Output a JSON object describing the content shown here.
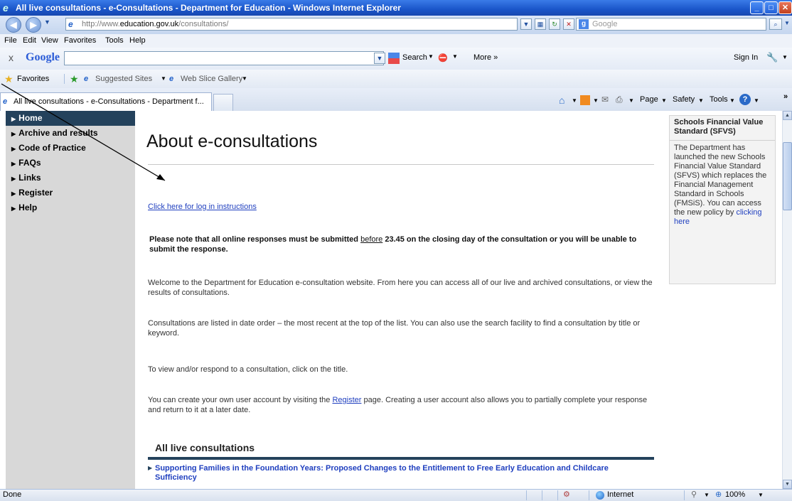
{
  "window": {
    "title": "All live consultations - e-Consultations - Department for Education - Windows Internet Explorer"
  },
  "address": {
    "url_prefix": "http://www.",
    "url_host": "education.gov.uk",
    "url_path": "/consultations/",
    "search_placeholder": "Google"
  },
  "menu": [
    "File",
    "Edit",
    "View",
    "Favorites",
    "Tools",
    "Help"
  ],
  "google_toolbar": {
    "close": "x",
    "brand": "Google",
    "search_label": "Search",
    "more_label": "More »",
    "signin_label": "Sign In"
  },
  "favorites_bar": {
    "favorites_label": "Favorites",
    "suggested_sites": "Suggested Sites",
    "web_slice_gallery": "Web Slice Gallery"
  },
  "tab": {
    "label": "All live consultations - e-Consultations - Department f..."
  },
  "command_bar": {
    "page": "Page",
    "safety": "Safety",
    "tools": "Tools"
  },
  "left_nav": [
    {
      "label": "Home",
      "active": true
    },
    {
      "label": "Archive and results",
      "active": false
    },
    {
      "label": "Code of Practice",
      "active": false
    },
    {
      "label": "FAQs",
      "active": false
    },
    {
      "label": "Links",
      "active": false
    },
    {
      "label": "Register",
      "active": false
    },
    {
      "label": "Help",
      "active": false
    }
  ],
  "main": {
    "heading": "About e-consultations",
    "login_link": "Click here for log in instructions",
    "notice_part1": "Please note that all online responses must be submitted ",
    "notice_underlined": "before",
    "notice_part2": " 23.45 on the closing day of the consultation or you will be unable to submit the response.",
    "para1": "Welcome to the Department for Education e-consultation website. From here you can access all of our live and archived consultations, or view the results of consultations.",
    "para2": "Consultations are listed in date order – the most recent at the top of the list.  You can also use the search facility to find a consultation by title or keyword.",
    "para3": "To view and/or respond to a consultation, click on the title.",
    "para4_part1": "You can create your own user account by visiting the ",
    "para4_link": "Register",
    "para4_part2": " page. Creating a user account also allows you to partially complete your response and return to it at a later date.",
    "live_heading": "All live consultations",
    "consultation_link": "Supporting Families in the Foundation Years: Proposed Changes to the Entitlement to Free Early Education and Childcare Sufficiency"
  },
  "right_box": {
    "title": "Schools Financial Value Standard (SFVS)",
    "body": "The Department has launched the new Schools Financial Value Standard (SFVS)  which replaces the Financial Management Standard in Schools (FMSiS). You can access the new policy by",
    "link": "clicking here"
  },
  "status": {
    "left": "Done",
    "zone": "Internet",
    "zoom": "100%"
  }
}
